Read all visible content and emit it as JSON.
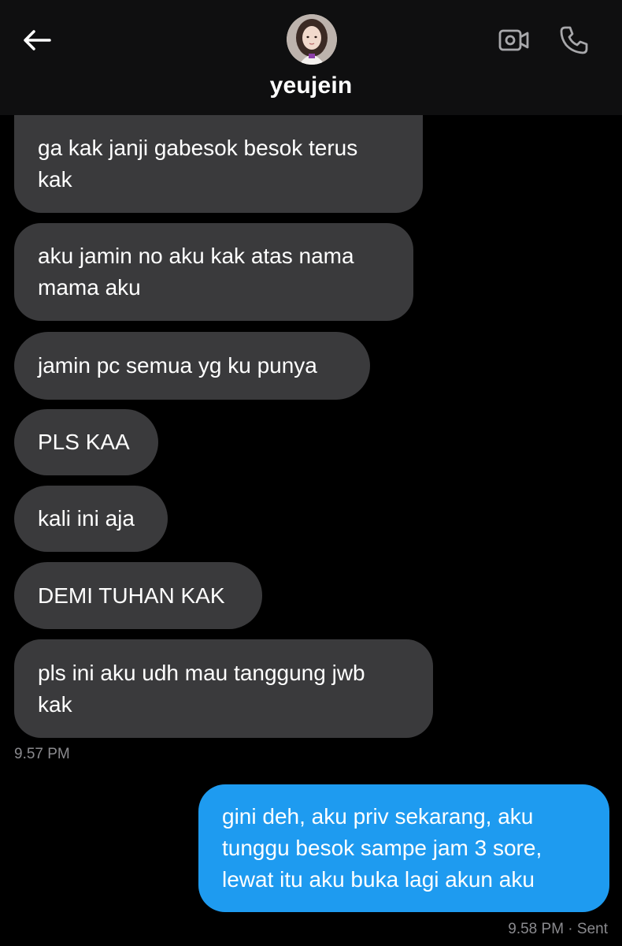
{
  "header": {
    "username": "yeujein",
    "back_icon": "arrow-left-icon",
    "video_icon": "video-camera-icon",
    "call_icon": "phone-icon"
  },
  "messages": [
    {
      "direction": "incoming",
      "text": "ga kak janji gabesok besok terus\nkak"
    },
    {
      "direction": "incoming",
      "text": "aku jamin no aku kak atas nama\nmama aku"
    },
    {
      "direction": "incoming",
      "text": "jamin pc semua yg ku punya"
    },
    {
      "direction": "incoming",
      "text": "PLS KAA"
    },
    {
      "direction": "incoming",
      "text": "kali ini aja"
    },
    {
      "direction": "incoming",
      "text": "DEMI TUHAN KAK"
    },
    {
      "direction": "incoming",
      "text": "pls ini aku udh mau tanggung jwb\nkak"
    },
    {
      "direction": "outgoing",
      "text": "gini deh, aku priv sekarang, aku\ntunggu besok sampe jam 3 sore,\nlewat itu aku buka lagi akun aku"
    }
  ],
  "timestamps": {
    "incoming": "9.57 PM",
    "outgoing": "9.58 PM · Sent"
  },
  "colors": {
    "background": "#000000",
    "header": "#0f0f10",
    "incoming_bubble": "#3a3a3c",
    "outgoing_bubble": "#1e9bf0",
    "timestamp_text": "#8a8a8e"
  }
}
